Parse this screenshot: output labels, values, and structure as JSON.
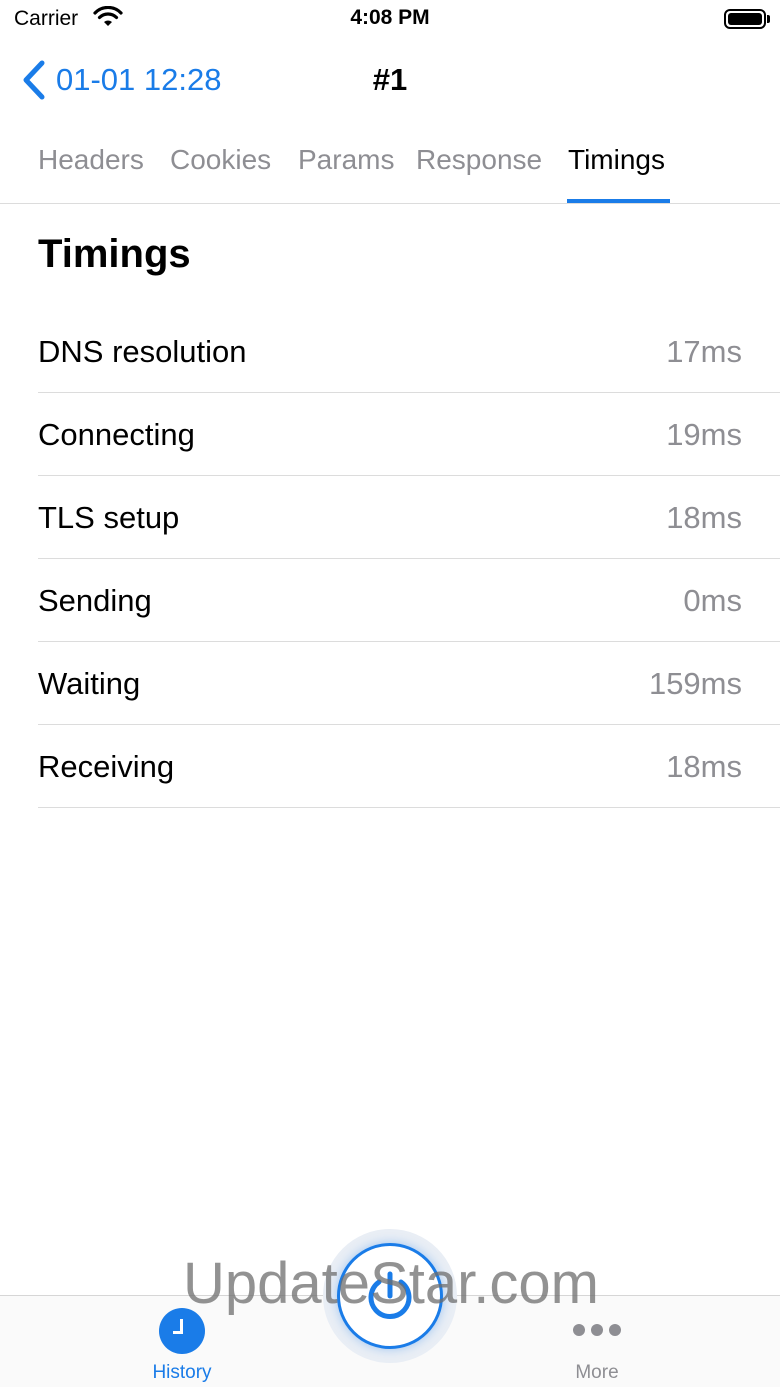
{
  "status_bar": {
    "carrier": "Carrier",
    "time": "4:08 PM",
    "icons": [
      "wifi-icon",
      "battery-icon"
    ]
  },
  "nav": {
    "back_label": "01-01 12:28",
    "title": "#1"
  },
  "tabs": [
    {
      "label": "Headers",
      "active": false
    },
    {
      "label": "Cookies",
      "active": false
    },
    {
      "label": "Params",
      "active": false
    },
    {
      "label": "Response",
      "active": false
    },
    {
      "label": "Timings",
      "active": true
    }
  ],
  "section": {
    "title": "Timings"
  },
  "timings": [
    {
      "label": "DNS resolution",
      "value": "17ms"
    },
    {
      "label": "Connecting",
      "value": "19ms"
    },
    {
      "label": "TLS setup",
      "value": "18ms"
    },
    {
      "label": "Sending",
      "value": "0ms"
    },
    {
      "label": "Waiting",
      "value": "159ms"
    },
    {
      "label": "Receiving",
      "value": "18ms"
    }
  ],
  "tab_bar": {
    "history_label": "History",
    "more_label": "More",
    "center_icon": "power-icon"
  },
  "watermark": "UpdateStar.com",
  "colors": {
    "accent": "#1a7ce8",
    "secondary_text": "#8e8e93",
    "separator": "#dcdcdc"
  }
}
